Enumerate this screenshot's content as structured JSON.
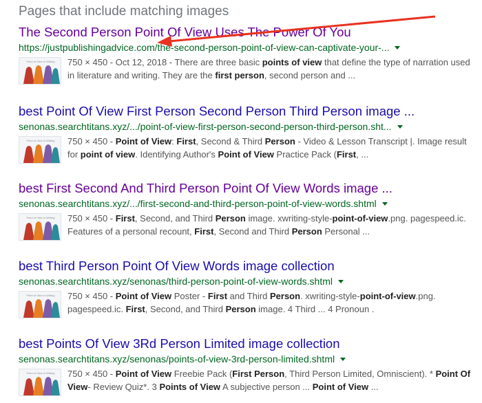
{
  "heading": "Pages that include matching images",
  "results": [
    {
      "title": "The Second Person Point Of View Uses The Power Of You",
      "visited": true,
      "url": "https://justpublishingadvice.com/the-second-person-point-of-view-can-captivate-your-...",
      "meta": "750 × 450 - Oct 12, 2018 - ",
      "snippet_parts": [
        {
          "t": "There are three basic "
        },
        {
          "t": "points of view",
          "b": true
        },
        {
          "t": " that define the type of narration used in literature and writing. They are the "
        },
        {
          "t": "first person",
          "b": true
        },
        {
          "t": ", second person and ..."
        }
      ]
    },
    {
      "title": "best Point Of View First Person Second Person Third Person image ...",
      "visited": false,
      "url": "senonas.searchtitans.xyz/.../point-of-view-first-person-second-person-third-person.sht...",
      "meta": "750 × 450 - ",
      "snippet_parts": [
        {
          "t": "Point of View",
          "b": true
        },
        {
          "t": ": "
        },
        {
          "t": "First",
          "b": true
        },
        {
          "t": ", Second & Third "
        },
        {
          "t": "Person",
          "b": true
        },
        {
          "t": " - Video & Lesson Transcript |. Image result for "
        },
        {
          "t": "point of view",
          "b": true
        },
        {
          "t": ". Identifying Author's "
        },
        {
          "t": "Point of View",
          "b": true
        },
        {
          "t": " Practice Pack ("
        },
        {
          "t": "First",
          "b": true
        },
        {
          "t": ", ..."
        }
      ]
    },
    {
      "title": "best First Second And Third Person Point Of View Words image ...",
      "visited": true,
      "url": "senonas.searchtitans.xyz/.../first-second-and-third-person-point-of-view-words.shtml",
      "meta": "750 × 450 - ",
      "snippet_parts": [
        {
          "t": "First",
          "b": true
        },
        {
          "t": ", Second, and Third "
        },
        {
          "t": "Person",
          "b": true
        },
        {
          "t": " image. xwriting-style-"
        },
        {
          "t": "point-of-view",
          "b": true
        },
        {
          "t": ".png. pagespeed.ic. Features of a personal recount, "
        },
        {
          "t": "First",
          "b": true
        },
        {
          "t": ", Second and Third "
        },
        {
          "t": "Person",
          "b": true
        },
        {
          "t": " Personal ..."
        }
      ]
    },
    {
      "title": "best Third Person Point Of View Words image collection",
      "visited": false,
      "url": "senonas.searchtitans.xyz/senonas/third-person-point-of-view-words.shtml",
      "meta": "750 × 450 - ",
      "snippet_parts": [
        {
          "t": "Point of View",
          "b": true
        },
        {
          "t": " Poster - "
        },
        {
          "t": "First",
          "b": true
        },
        {
          "t": " and Third "
        },
        {
          "t": "Person",
          "b": true
        },
        {
          "t": ". xwriting-style-"
        },
        {
          "t": "point-of-view",
          "b": true
        },
        {
          "t": ".png. pagespeed.ic. "
        },
        {
          "t": "First",
          "b": true
        },
        {
          "t": ", Second, and Third "
        },
        {
          "t": "Person",
          "b": true
        },
        {
          "t": " image. 4 Third ... 4 Pronoun ."
        }
      ]
    },
    {
      "title": "best Points Of View 3Rd Person Limited image collection",
      "visited": false,
      "url": "senonas.searchtitans.xyz/senonas/points-of-view-3rd-person-limited.shtml",
      "meta": "750 × 450 - ",
      "snippet_parts": [
        {
          "t": "Point of View",
          "b": true
        },
        {
          "t": " Freebie Pack ("
        },
        {
          "t": "First Person",
          "b": true
        },
        {
          "t": ", Third Person Limited, Omniscient). * "
        },
        {
          "t": "Point Of View",
          "b": true
        },
        {
          "t": "- Review Quiz*. 3 "
        },
        {
          "t": "Points of View",
          "b": true
        },
        {
          "t": " A subjective person ... "
        },
        {
          "t": "Point of View",
          "b": true
        },
        {
          "t": " ..."
        }
      ]
    }
  ],
  "colors": {
    "visited_link": "#660099",
    "link": "#1a0dab",
    "url_green": "#006621",
    "snippet_gray": "#545454",
    "annotation_red": "#e8321f"
  },
  "icons": {
    "url_dropdown": "caret-down-icon",
    "annotation": "red-arrow-annotation"
  }
}
